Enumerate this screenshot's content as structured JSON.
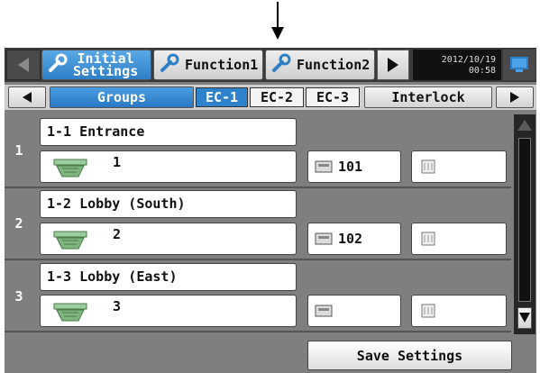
{
  "header": {
    "tab_initial_line1": "Initial",
    "tab_initial_line2": "Settings",
    "tab_function1": "Function1",
    "tab_function2": "Function2",
    "date": "2012/10/19",
    "time": "00:58"
  },
  "subnav": {
    "groups_label": "Groups",
    "ec_tabs": [
      "EC-1",
      "EC-2",
      "EC-3"
    ],
    "selected_ec": "EC-1",
    "interlock_label": "Interlock"
  },
  "rows": [
    {
      "index": "1",
      "name": "1-1 Entrance",
      "unit": "1",
      "address": "101"
    },
    {
      "index": "2",
      "name": "1-2 Lobby (South)",
      "unit": "2",
      "address": "102"
    },
    {
      "index": "3",
      "name": "1-3 Lobby (East)",
      "unit": "3",
      "address": ""
    }
  ],
  "footer": {
    "save_label": "Save Settings"
  },
  "icons": [
    "down-arrow-pointer-icon",
    "left-arrow-icon",
    "right-arrow-icon",
    "wrench-icon",
    "monitor-icon",
    "indoor-unit-icon",
    "controller-icon",
    "lossnay-icon",
    "scroll-up-icon",
    "scroll-down-icon"
  ],
  "colors": {
    "active_tab": "#2f7fc7",
    "background": "#7f7f7f",
    "topbar": "#3a3a3a"
  }
}
